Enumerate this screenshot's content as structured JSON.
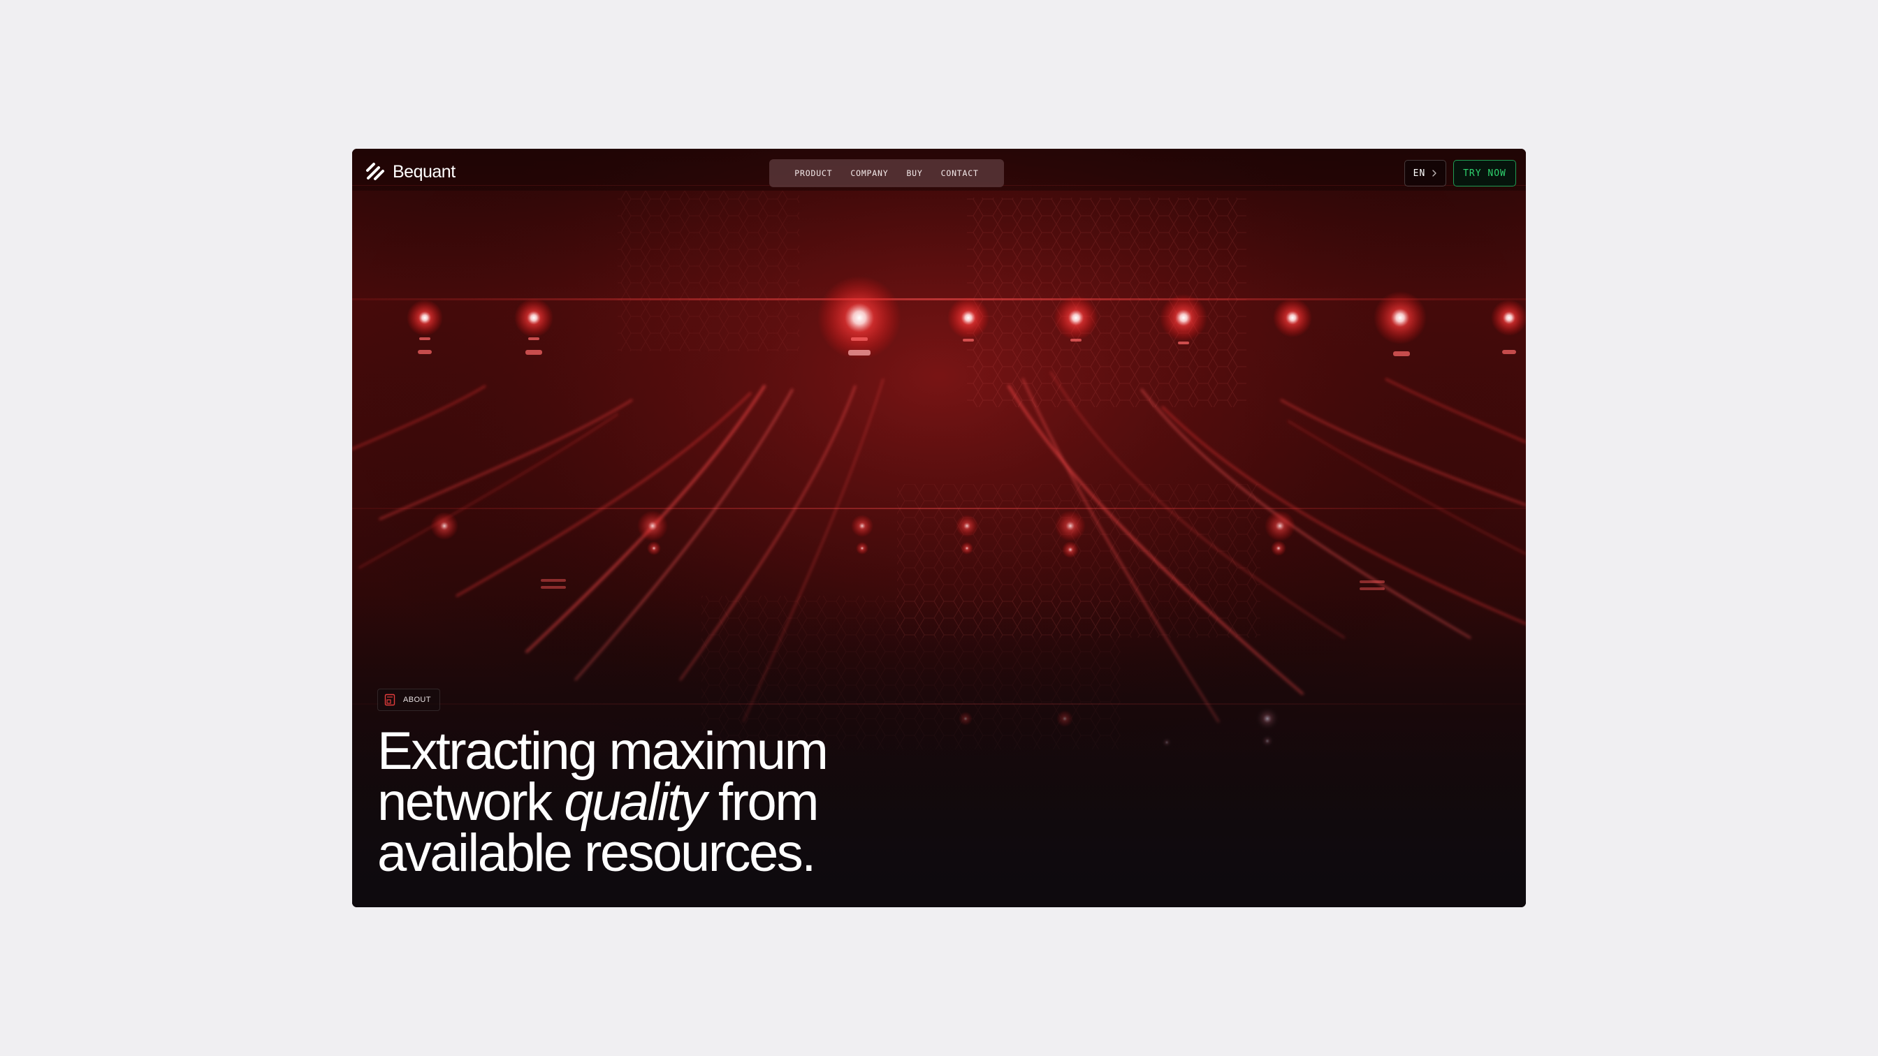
{
  "brand": {
    "name": "Bequant",
    "accent": "#2fd46f",
    "hero_glow": "#ff3a3a"
  },
  "nav": {
    "items": [
      {
        "label": "PRODUCT"
      },
      {
        "label": "COMPANY"
      },
      {
        "label": "BUY"
      },
      {
        "label": "CONTACT"
      }
    ]
  },
  "header": {
    "language": "EN",
    "language_icon": "chevron-right-icon",
    "cta_label": "TRY NOW"
  },
  "hero": {
    "badge_icon": "document-icon",
    "badge_label": "ABOUT",
    "headline": {
      "line1": "Extracting maximum",
      "line2_pre": "network ",
      "line2_em": "quality",
      "line2_post": " from",
      "line3": "available resources."
    }
  }
}
